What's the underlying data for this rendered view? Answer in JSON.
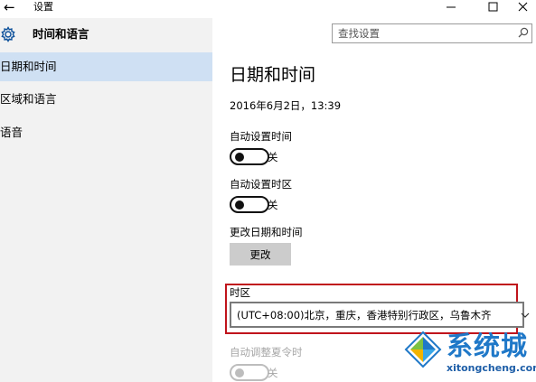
{
  "window": {
    "back_glyph": "←",
    "title": "设置",
    "minimize_glyph": "─",
    "maximize_glyph": "☐",
    "close_glyph": "✕"
  },
  "sidebar": {
    "title": "时间和语言",
    "icon": "gear-icon",
    "items": [
      {
        "label": "日期和时间",
        "selected": true
      },
      {
        "label": "区域和语言",
        "selected": false
      },
      {
        "label": "语音",
        "selected": false
      }
    ]
  },
  "search": {
    "placeholder": "查找设置",
    "icon": "search-icon"
  },
  "main": {
    "title": "日期和时间",
    "current_datetime": "2016年6月2日，13:39",
    "auto_time": {
      "label": "自动设置时间",
      "state": "关",
      "on": false
    },
    "auto_timezone": {
      "label": "自动设置时区",
      "state": "关",
      "on": false
    },
    "change_datetime": {
      "label": "更改日期和时间",
      "button": "更改"
    },
    "timezone": {
      "label": "时区",
      "value": "(UTC+08:00)北京，重庆，香港特别行政区，乌鲁木齐"
    },
    "dst": {
      "label": "自动调整夏令时",
      "state": "关",
      "on": false,
      "disabled": true
    }
  },
  "watermark": {
    "text": "系统城",
    "url": "xitongcheng.com"
  },
  "colors": {
    "selected_nav": "#cfe0f3",
    "sidebar_bg": "#f2f2f2",
    "highlight_box": "#c0141c",
    "button_bg": "#cccccc",
    "watermark_blue": "#1f78c8"
  }
}
